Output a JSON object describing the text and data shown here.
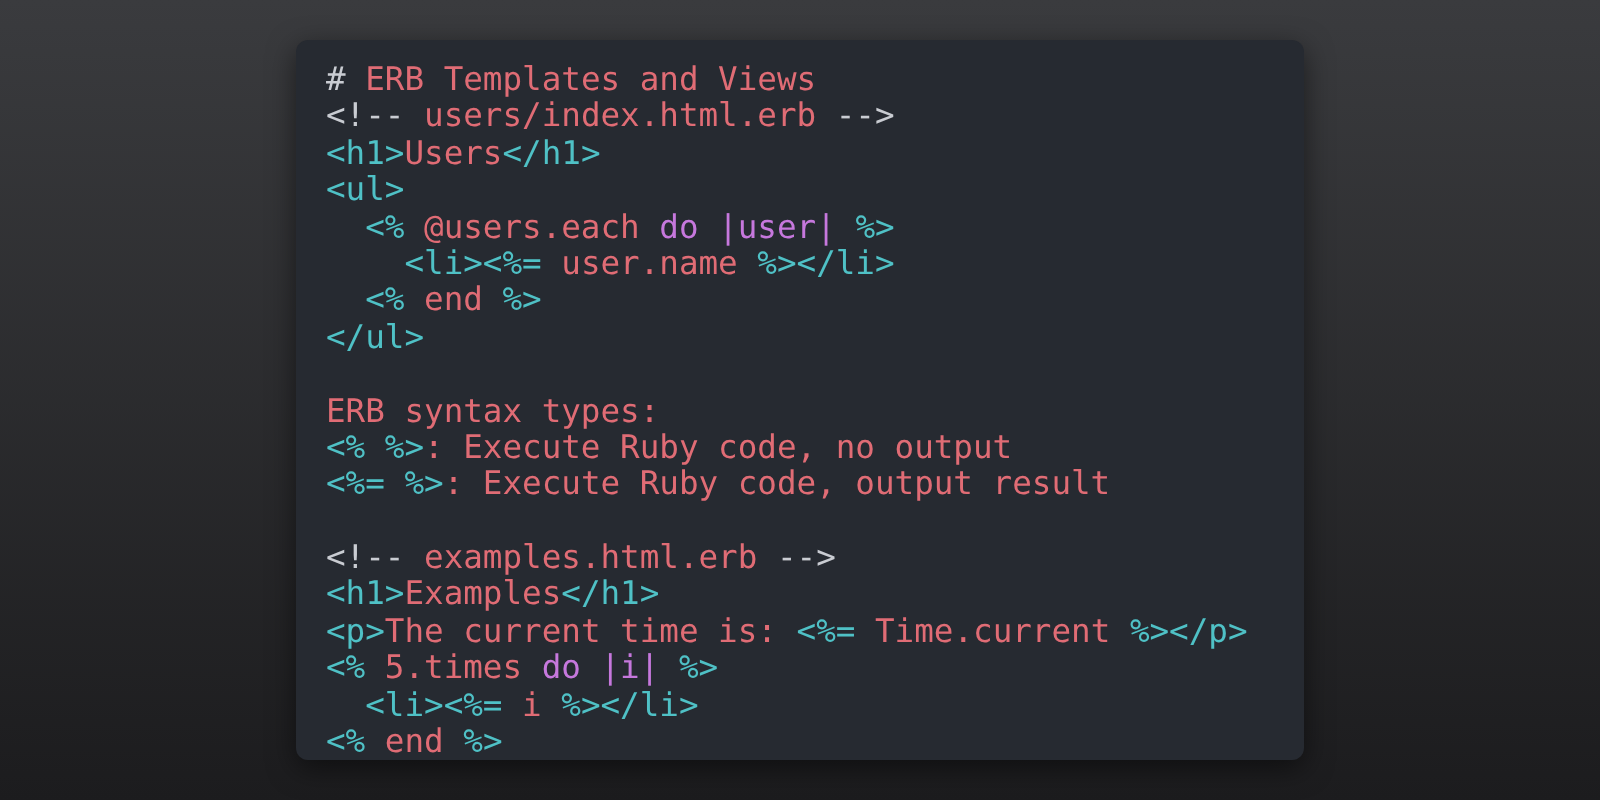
{
  "lines": [
    {
      "tokens": [
        {
          "text": "#",
          "kind": "punct"
        },
        {
          "text": " ERB Templates and Views",
          "kind": "text"
        }
      ]
    },
    {
      "tokens": [
        {
          "text": "<!--",
          "kind": "punct"
        },
        {
          "text": " users/index.html.erb ",
          "kind": "text"
        },
        {
          "text": "-->",
          "kind": "punct"
        }
      ]
    },
    {
      "tokens": [
        {
          "text": "<h1>",
          "kind": "tag"
        },
        {
          "text": "Users",
          "kind": "text"
        },
        {
          "text": "</h1>",
          "kind": "tag"
        }
      ]
    },
    {
      "tokens": [
        {
          "text": "<ul>",
          "kind": "tag"
        }
      ]
    },
    {
      "tokens": [
        {
          "text": "  <% ",
          "kind": "tag"
        },
        {
          "text": "@users.each ",
          "kind": "text"
        },
        {
          "text": "do |user|",
          "kind": "keyword"
        },
        {
          "text": " %>",
          "kind": "tag"
        }
      ]
    },
    {
      "tokens": [
        {
          "text": "    <li><%= ",
          "kind": "tag"
        },
        {
          "text": "user.name ",
          "kind": "text"
        },
        {
          "text": "%></li>",
          "kind": "tag"
        }
      ]
    },
    {
      "tokens": [
        {
          "text": "  <% ",
          "kind": "tag"
        },
        {
          "text": "end ",
          "kind": "text"
        },
        {
          "text": "%>",
          "kind": "tag"
        }
      ]
    },
    {
      "tokens": [
        {
          "text": "</ul>",
          "kind": "tag"
        }
      ]
    },
    {
      "blank_before": true,
      "tokens": [
        {
          "text": "ERB syntax types:",
          "kind": "text"
        }
      ]
    },
    {
      "tokens": [
        {
          "text": "<% %>",
          "kind": "tag"
        },
        {
          "text": ": Execute Ruby code, no output",
          "kind": "text"
        }
      ]
    },
    {
      "tokens": [
        {
          "text": "<%= %>",
          "kind": "tag"
        },
        {
          "text": ": Execute Ruby code, output result",
          "kind": "text"
        }
      ]
    },
    {
      "blank_before": true,
      "tokens": [
        {
          "text": "<!--",
          "kind": "punct"
        },
        {
          "text": " examples.html.erb ",
          "kind": "text"
        },
        {
          "text": "-->",
          "kind": "punct"
        }
      ]
    },
    {
      "tokens": [
        {
          "text": "<h1>",
          "kind": "tag"
        },
        {
          "text": "Examples",
          "kind": "text"
        },
        {
          "text": "</h1>",
          "kind": "tag"
        }
      ]
    },
    {
      "tokens": [
        {
          "text": "<p>",
          "kind": "tag"
        },
        {
          "text": "The current time is: ",
          "kind": "text"
        },
        {
          "text": "<%= ",
          "kind": "tag"
        },
        {
          "text": "Time.current ",
          "kind": "text"
        },
        {
          "text": "%></p>",
          "kind": "tag"
        }
      ]
    },
    {
      "tokens": [
        {
          "text": "<% ",
          "kind": "tag"
        },
        {
          "text": "5.times ",
          "kind": "text"
        },
        {
          "text": "do |i|",
          "kind": "keyword"
        },
        {
          "text": " %>",
          "kind": "tag"
        }
      ]
    },
    {
      "tokens": [
        {
          "text": "  <li><%= ",
          "kind": "tag"
        },
        {
          "text": "i ",
          "kind": "text"
        },
        {
          "text": "%></li>",
          "kind": "tag"
        }
      ]
    },
    {
      "tokens": [
        {
          "text": "<% ",
          "kind": "tag"
        },
        {
          "text": "end ",
          "kind": "text"
        },
        {
          "text": "%>",
          "kind": "tag"
        }
      ]
    }
  ]
}
